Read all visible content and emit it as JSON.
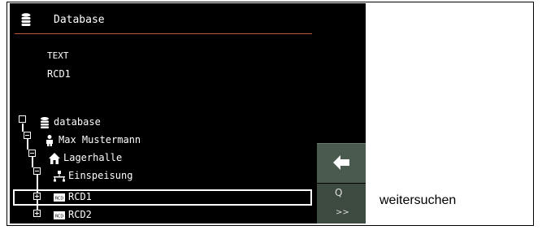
{
  "header": {
    "title": "Database",
    "icon": "database-icon"
  },
  "field": {
    "label": "TEXT",
    "value": "RCD1"
  },
  "tree": {
    "items": [
      {
        "label": "database",
        "icon": "database-icon"
      },
      {
        "label": "Max Mustermann",
        "icon": "person-icon"
      },
      {
        "label": "Lagerhalle",
        "icon": "house-icon"
      },
      {
        "label": "Einspeisung",
        "icon": "network-icon"
      },
      {
        "label": "RCD1",
        "icon": "rcd-icon",
        "selected": true
      },
      {
        "label": "RCD2",
        "icon": "rcd-icon"
      }
    ]
  },
  "buttons": {
    "back_icon": "back-arrow-icon",
    "search_glyph": "Q",
    "search_next": ">>"
  },
  "caption": "weitersuchen",
  "colors": {
    "screen_bg": "#000000",
    "header_rule": "#c0563f",
    "button_bg": "#4a5a4e"
  }
}
